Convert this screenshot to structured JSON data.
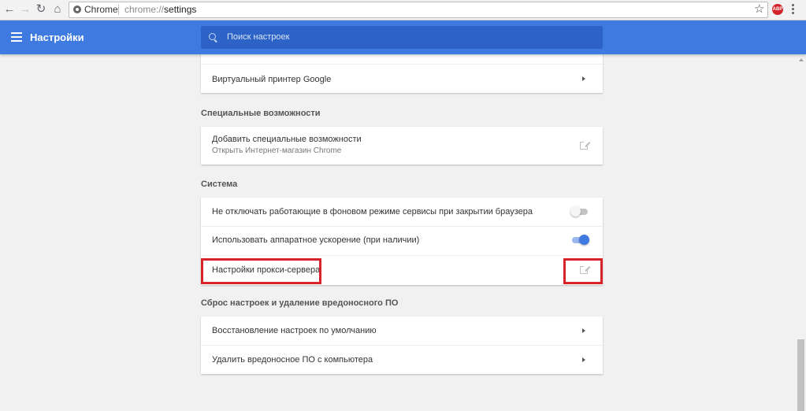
{
  "browser": {
    "chip_label": "Chrome",
    "url_scheme": "chrome://",
    "url_path": "settings",
    "extension_badge": "ABP"
  },
  "header": {
    "title": "Настройки",
    "search_placeholder": "Поиск настроек"
  },
  "print_card": {
    "virtual_printer": "Виртуальный принтер Google"
  },
  "accessibility": {
    "section_title": "Специальные возможности",
    "add_title": "Добавить специальные возможности",
    "add_subtitle": "Открыть Интернет-магазин Chrome"
  },
  "system": {
    "section_title": "Система",
    "background_apps": "Не отключать работающие в фоновом режиме сервисы при закрытии браузера",
    "background_apps_enabled": false,
    "hardware_accel": "Использовать аппаратное ускорение (при наличии)",
    "hardware_accel_enabled": true,
    "proxy_settings": "Настройки прокси-сервера"
  },
  "reset": {
    "section_title": "Сброс настроек и удаление вредоносного ПО",
    "restore_defaults": "Восстановление настроек по умолчанию",
    "cleanup": "Удалить вредоносное ПО с компьютера"
  },
  "colors": {
    "accent": "#3f7ae0",
    "highlight": "#d8232a"
  }
}
